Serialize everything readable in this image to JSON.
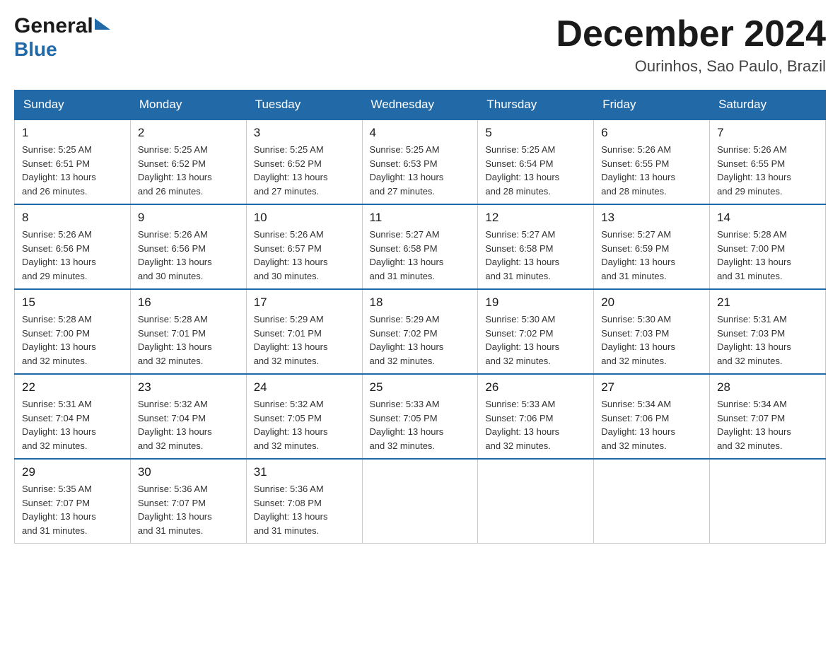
{
  "logo": {
    "general": "General",
    "blue": "Blue",
    "arrowColor": "#2269a8"
  },
  "header": {
    "title": "December 2024",
    "location": "Ourinhos, Sao Paulo, Brazil"
  },
  "weekdays": [
    "Sunday",
    "Monday",
    "Tuesday",
    "Wednesday",
    "Thursday",
    "Friday",
    "Saturday"
  ],
  "weeks": [
    [
      {
        "day": "1",
        "sunrise": "5:25 AM",
        "sunset": "6:51 PM",
        "daylight": "13 hours and 26 minutes."
      },
      {
        "day": "2",
        "sunrise": "5:25 AM",
        "sunset": "6:52 PM",
        "daylight": "13 hours and 26 minutes."
      },
      {
        "day": "3",
        "sunrise": "5:25 AM",
        "sunset": "6:52 PM",
        "daylight": "13 hours and 27 minutes."
      },
      {
        "day": "4",
        "sunrise": "5:25 AM",
        "sunset": "6:53 PM",
        "daylight": "13 hours and 27 minutes."
      },
      {
        "day": "5",
        "sunrise": "5:25 AM",
        "sunset": "6:54 PM",
        "daylight": "13 hours and 28 minutes."
      },
      {
        "day": "6",
        "sunrise": "5:26 AM",
        "sunset": "6:55 PM",
        "daylight": "13 hours and 28 minutes."
      },
      {
        "day": "7",
        "sunrise": "5:26 AM",
        "sunset": "6:55 PM",
        "daylight": "13 hours and 29 minutes."
      }
    ],
    [
      {
        "day": "8",
        "sunrise": "5:26 AM",
        "sunset": "6:56 PM",
        "daylight": "13 hours and 29 minutes."
      },
      {
        "day": "9",
        "sunrise": "5:26 AM",
        "sunset": "6:56 PM",
        "daylight": "13 hours and 30 minutes."
      },
      {
        "day": "10",
        "sunrise": "5:26 AM",
        "sunset": "6:57 PM",
        "daylight": "13 hours and 30 minutes."
      },
      {
        "day": "11",
        "sunrise": "5:27 AM",
        "sunset": "6:58 PM",
        "daylight": "13 hours and 31 minutes."
      },
      {
        "day": "12",
        "sunrise": "5:27 AM",
        "sunset": "6:58 PM",
        "daylight": "13 hours and 31 minutes."
      },
      {
        "day": "13",
        "sunrise": "5:27 AM",
        "sunset": "6:59 PM",
        "daylight": "13 hours and 31 minutes."
      },
      {
        "day": "14",
        "sunrise": "5:28 AM",
        "sunset": "7:00 PM",
        "daylight": "13 hours and 31 minutes."
      }
    ],
    [
      {
        "day": "15",
        "sunrise": "5:28 AM",
        "sunset": "7:00 PM",
        "daylight": "13 hours and 32 minutes."
      },
      {
        "day": "16",
        "sunrise": "5:28 AM",
        "sunset": "7:01 PM",
        "daylight": "13 hours and 32 minutes."
      },
      {
        "day": "17",
        "sunrise": "5:29 AM",
        "sunset": "7:01 PM",
        "daylight": "13 hours and 32 minutes."
      },
      {
        "day": "18",
        "sunrise": "5:29 AM",
        "sunset": "7:02 PM",
        "daylight": "13 hours and 32 minutes."
      },
      {
        "day": "19",
        "sunrise": "5:30 AM",
        "sunset": "7:02 PM",
        "daylight": "13 hours and 32 minutes."
      },
      {
        "day": "20",
        "sunrise": "5:30 AM",
        "sunset": "7:03 PM",
        "daylight": "13 hours and 32 minutes."
      },
      {
        "day": "21",
        "sunrise": "5:31 AM",
        "sunset": "7:03 PM",
        "daylight": "13 hours and 32 minutes."
      }
    ],
    [
      {
        "day": "22",
        "sunrise": "5:31 AM",
        "sunset": "7:04 PM",
        "daylight": "13 hours and 32 minutes."
      },
      {
        "day": "23",
        "sunrise": "5:32 AM",
        "sunset": "7:04 PM",
        "daylight": "13 hours and 32 minutes."
      },
      {
        "day": "24",
        "sunrise": "5:32 AM",
        "sunset": "7:05 PM",
        "daylight": "13 hours and 32 minutes."
      },
      {
        "day": "25",
        "sunrise": "5:33 AM",
        "sunset": "7:05 PM",
        "daylight": "13 hours and 32 minutes."
      },
      {
        "day": "26",
        "sunrise": "5:33 AM",
        "sunset": "7:06 PM",
        "daylight": "13 hours and 32 minutes."
      },
      {
        "day": "27",
        "sunrise": "5:34 AM",
        "sunset": "7:06 PM",
        "daylight": "13 hours and 32 minutes."
      },
      {
        "day": "28",
        "sunrise": "5:34 AM",
        "sunset": "7:07 PM",
        "daylight": "13 hours and 32 minutes."
      }
    ],
    [
      {
        "day": "29",
        "sunrise": "5:35 AM",
        "sunset": "7:07 PM",
        "daylight": "13 hours and 31 minutes."
      },
      {
        "day": "30",
        "sunrise": "5:36 AM",
        "sunset": "7:07 PM",
        "daylight": "13 hours and 31 minutes."
      },
      {
        "day": "31",
        "sunrise": "5:36 AM",
        "sunset": "7:08 PM",
        "daylight": "13 hours and 31 minutes."
      },
      null,
      null,
      null,
      null
    ]
  ],
  "labels": {
    "sunrise": "Sunrise:",
    "sunset": "Sunset:",
    "daylight": "Daylight:"
  },
  "colors": {
    "header_bg": "#2269a8",
    "border_top": "#2269a8"
  }
}
